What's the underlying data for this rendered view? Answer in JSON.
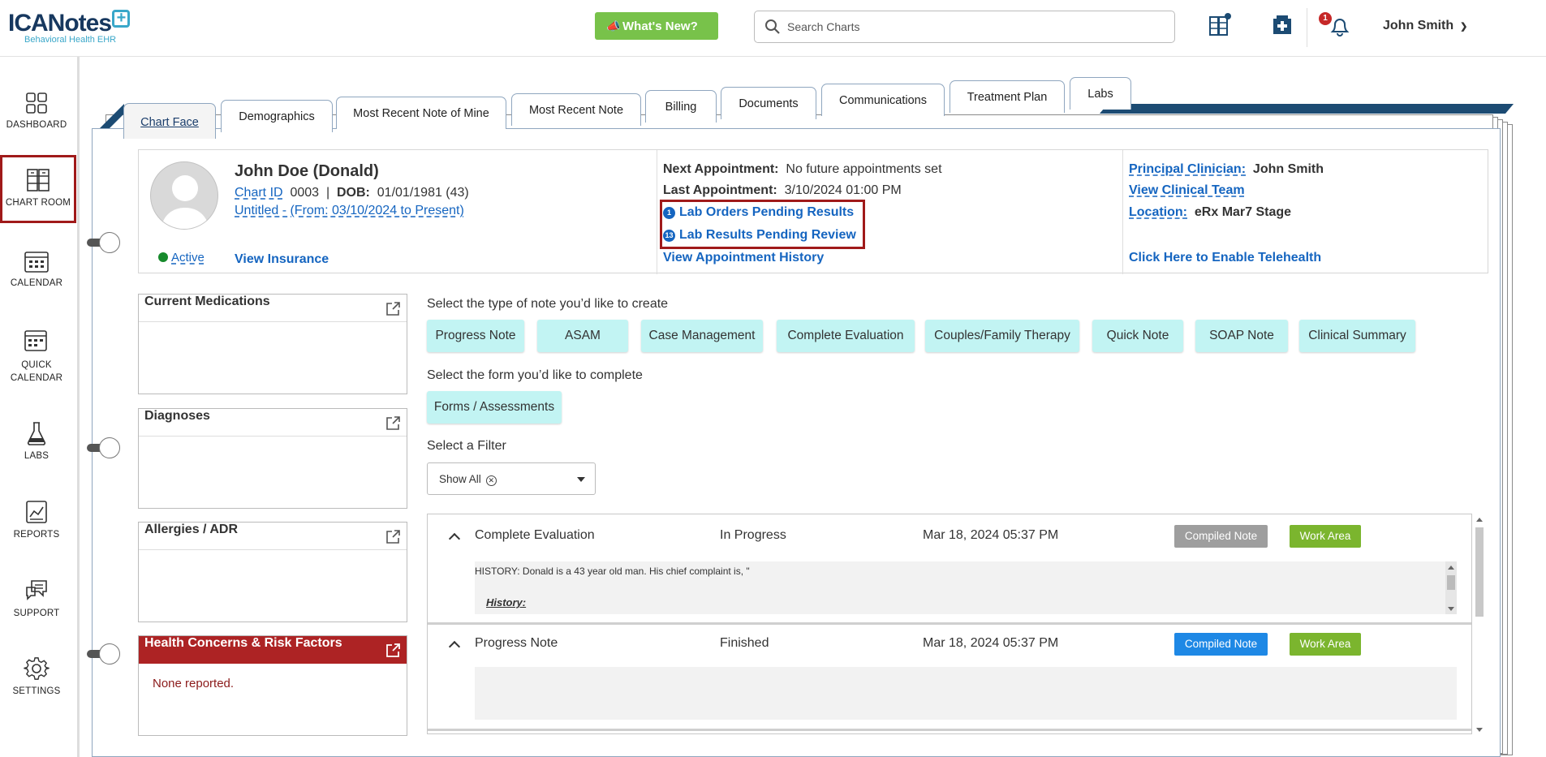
{
  "header": {
    "logo_main": "ICANotes",
    "logo_sub": "Behavioral Health EHR",
    "whats_new": "What's New?",
    "search_placeholder": "Search Charts",
    "notification_count": "1",
    "user_name": "John Smith"
  },
  "sidebar": [
    {
      "label": "DASHBOARD",
      "icon": "dashboard-icon"
    },
    {
      "label": "CHART ROOM",
      "icon": "chart-room-icon"
    },
    {
      "label": "CALENDAR",
      "icon": "calendar-icon"
    },
    {
      "label": "QUICK",
      "label2": "CALENDAR",
      "icon": "quick-calendar-icon"
    },
    {
      "label": "LABS",
      "icon": "flask-icon"
    },
    {
      "label": "REPORTS",
      "icon": "reports-icon"
    },
    {
      "label": "SUPPORT",
      "icon": "support-icon"
    },
    {
      "label": "SETTINGS",
      "icon": "gear-icon"
    }
  ],
  "tabs": [
    "Chart Face",
    "Demographics",
    "Most Recent Note of Mine",
    "Most Recent Note",
    "Billing",
    "Documents",
    "Communications",
    "Treatment Plan",
    "Labs"
  ],
  "patient": {
    "name": "John Doe (Donald)",
    "chart_id_label": "Chart ID",
    "chart_id": "0003",
    "sep": "|",
    "dob_label": "DOB:",
    "dob": "01/01/1981 (43)",
    "episode": "Untitled - (From: 03/10/2024 to Present)",
    "status": "Active",
    "view_insurance": "View Insurance"
  },
  "appointments": {
    "next_label": "Next Appointment:",
    "next_value": "No future appointments set",
    "last_label": "Last Appointment:",
    "last_value": "3/10/2024 01:00 PM",
    "lab_orders_count": "1",
    "lab_orders": "Lab Orders Pending Results",
    "lab_results_count": "13",
    "lab_results": "Lab Results Pending Review",
    "history": "View Appointment History"
  },
  "clinician": {
    "principal_label": "Principal Clinician:",
    "principal_value": "John Smith",
    "team": "View Clinical Team",
    "location_label": "Location:",
    "location_value": "eRx Mar7 Stage",
    "telehealth": "Click Here to Enable Telehealth"
  },
  "widgets": {
    "medications": "Current Medications",
    "diagnoses": "Diagnoses",
    "allergies": "Allergies / ADR",
    "health": "Health Concerns & Risk Factors",
    "health_body": "None reported."
  },
  "center": {
    "note_prompt": "Select the type of note you’d like to create",
    "note_types": [
      "Progress Note",
      "ASAM",
      "Case Management",
      "Complete Evaluation",
      "Couples/Family Therapy",
      "Quick Note",
      "SOAP Note",
      "Clinical Summary"
    ],
    "form_prompt": "Select the form you’d like to complete",
    "form_button": "Forms / Assessments",
    "filter_prompt": "Select a Filter",
    "filter_value": "Show All"
  },
  "notes": [
    {
      "type": "Complete Evaluation",
      "status": "In Progress",
      "date": "Mar 18, 2024 05:37 PM",
      "compiled": "Compiled Note",
      "work": "Work Area",
      "preview_line": "HISTORY: Donald is a 43 year old man. His chief complaint is, \"",
      "preview_heading": "History:"
    },
    {
      "type": "Progress Note",
      "status": "Finished",
      "date": "Mar 18, 2024 05:37 PM",
      "compiled": "Compiled Note",
      "work": "Work Area"
    }
  ],
  "colors": {
    "accent_green": "#78c24a",
    "link_blue": "#1565c0",
    "highlight_red": "#a01a1a",
    "note_button": "#c2f4f3",
    "compiled_grey": "#9e9e9e",
    "compiled_blue": "#1e88e5",
    "work_green": "#7bb52e"
  }
}
